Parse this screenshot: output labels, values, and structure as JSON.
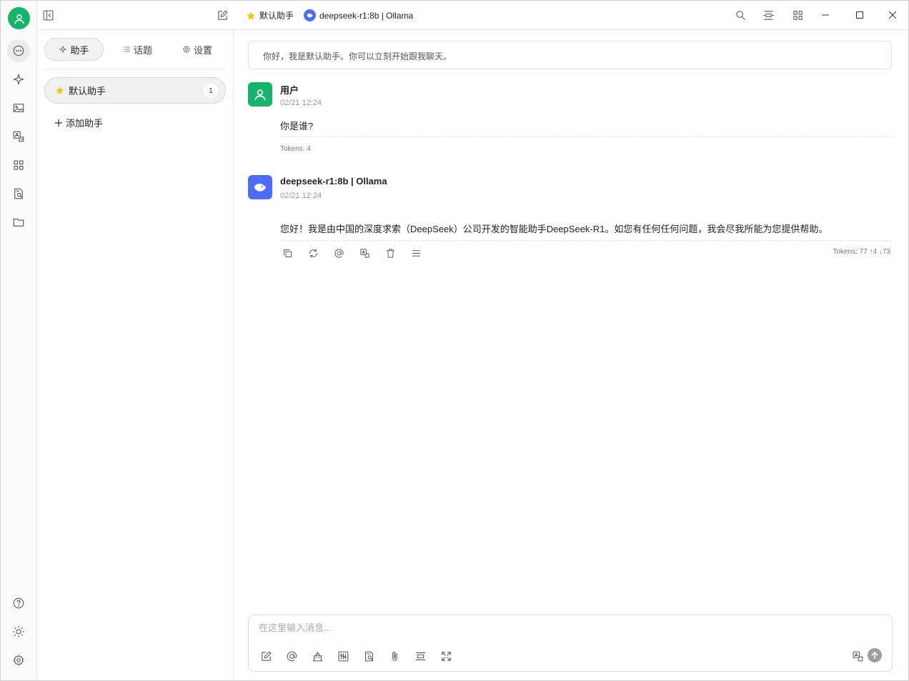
{
  "colors": {
    "accent": "#14b46b",
    "model_logo": "#4d6bfe",
    "star": "#f5c518"
  },
  "topbar": {
    "assistant_title": "默认助手",
    "model_title": "deepseek-r1:8b | Ollama"
  },
  "rail": {
    "icons": [
      "chat-icon",
      "sparkle-icon",
      "image-icon",
      "translate-icon",
      "apps-icon",
      "knowledge-icon",
      "folder-icon",
      "help-icon",
      "theme-icon",
      "settings-icon"
    ]
  },
  "panel": {
    "tabs": [
      {
        "label": "助手",
        "icon": "sparkle-icon"
      },
      {
        "label": "话题",
        "icon": "list-icon"
      },
      {
        "label": "设置",
        "icon": "gear-icon"
      }
    ],
    "assistants": [
      {
        "name": "默认助手",
        "count": "1"
      }
    ],
    "add_label": "添加助手"
  },
  "chat": {
    "greeting": "你好，我是默认助手。你可以立刻开始跟我聊天。",
    "messages": [
      {
        "name": "用户",
        "time": "02/21 12:24",
        "text": "你是谁?",
        "tokens": "Tokens: 4"
      },
      {
        "name": "deepseek-r1:8b | Ollama",
        "time": "02/21 12:24",
        "text": "您好！我是由中国的深度求索（DeepSeek）公司开发的智能助手DeepSeek-R1。如您有任何任何问题，我会尽我所能为您提供帮助。",
        "tokens": "Tokens: 77 ↑4 ↓73"
      }
    ],
    "actions": [
      "copy-icon",
      "regenerate-icon",
      "mention-icon",
      "translate-icon",
      "delete-icon",
      "menu-icon"
    ]
  },
  "input": {
    "placeholder": "在这里输入消息...",
    "value": "",
    "tools": [
      "new-topic-icon",
      "mention-icon",
      "web-icon",
      "settings-sliders-icon",
      "knowledge-icon",
      "attach-icon",
      "clear-icon",
      "expand-icon"
    ]
  }
}
